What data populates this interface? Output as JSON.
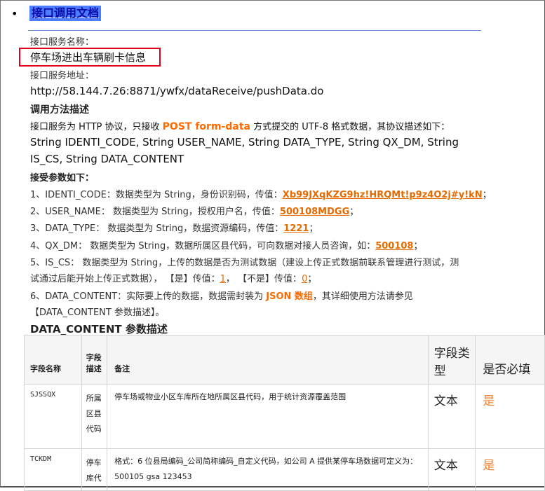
{
  "header": {
    "title_link": "接口调用文档"
  },
  "service": {
    "name_label": "接口服务名称：",
    "name_value": "停车场进出车辆刷卡信息",
    "address_label": "接口服务地址：",
    "address_value": "http://58.144.7.26:8871/ywfx/dataReceive/pushData.do"
  },
  "method": {
    "heading": "调用方法描述",
    "desc_prefix": "接口服务为 HTTP 协议，只接收 ",
    "desc_highlight": "POST form-data",
    "desc_suffix": " 方式提交的 UTF-8 格式数据，其协议描述如下：",
    "signature_line1": "String IDENTI_CODE, String USER_NAME, String DATA_TYPE, String QX_DM, String",
    "signature_line2": "IS_CS, String DATA_CONTENT"
  },
  "params": {
    "heading": "接受参数如下：",
    "p1_text": "1、IDENTI_CODE：数据类型为 String，身份识别码，传值：",
    "p1_value": "Xb99JXqKZG9hz!HRQMt!p9z4O2j#y!kN",
    "p1_end": "；",
    "p2_text": "2、USER_NAME：  数据类型为 String，授权用户名，传值：",
    "p2_value": "500108MDGG",
    "p2_end": "；",
    "p3_text": "3、DATA_TYPE：  数据类型为 String，数据资源编码，传值：",
    "p3_value": "1221",
    "p3_end": "；",
    "p4_text": "4、QX_DM：  数据类型为 String，数据所属区县代码，可向数据对接人员咨询，如：",
    "p4_value": "500108",
    "p4_end": "；",
    "p5_line1": "5、IS_CS：  数据类型为 String，上传的数据是否为测试数据（建设上传正式数据前联系管理进行测试，测",
    "p5_line2_a": "试通过后能开始上传正式数据），  【是】传值：",
    "p5_yes_value": "1",
    "p5_line2_b": "，  【不是】传值：",
    "p5_no_value": "0",
    "p5_end": "；",
    "p6_text": "6、DATA_CONTENT：实际要上传的数据，数据需封装为 ",
    "p6_highlight": "JSON 数组",
    "p6_suffix": "，其详细使用方法请参见",
    "p6_line2": "【DATA_CONTENT 参数描述】。"
  },
  "content_section": {
    "heading": "DATA_CONTENT 参数描述"
  },
  "table": {
    "headers": [
      "字段名称",
      "字段描述",
      "备注",
      "字段类型",
      "是否必填"
    ],
    "rows": [
      {
        "name": "SJSSQX",
        "desc": "所属区县代码",
        "remark": "停车场或物业小区车库所在地所属区县代码，用于统计资源覆盖范围",
        "remark2": "",
        "type": "文本",
        "required": "是"
      },
      {
        "name": "TCKDM",
        "desc": "停车库代",
        "remark": "格式：6 位县局编码_公司简称编码_自定义代码，如公司 A 提供某停车场数据可定义为：",
        "remark2": "500105 gsa 123453",
        "type": "文本",
        "required": "是"
      }
    ]
  }
}
